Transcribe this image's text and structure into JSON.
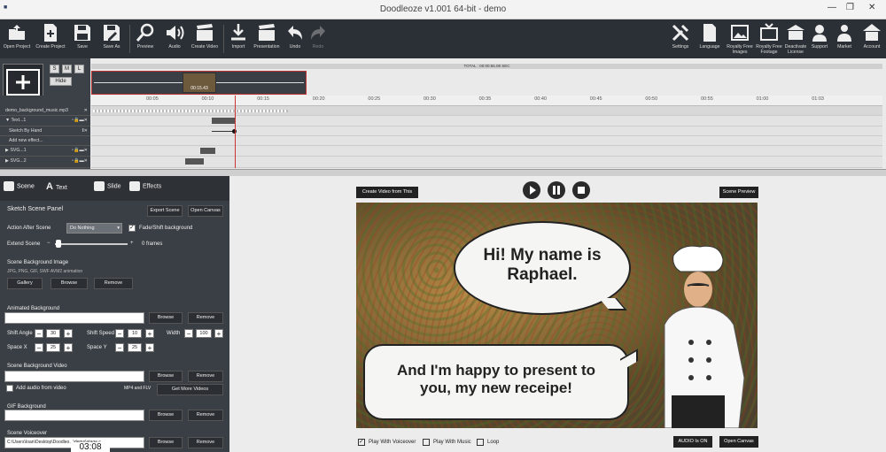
{
  "window": {
    "title": "Doodleoze v1.001 64-bit - demo"
  },
  "toolbar": {
    "left": [
      {
        "label": "Open Project",
        "icon": "folder-upload-icon"
      },
      {
        "label": "Create Project",
        "icon": "new-file-icon"
      },
      {
        "label": "Save",
        "icon": "save-icon"
      },
      {
        "label": "Save As",
        "icon": "save-as-icon"
      },
      {
        "label": "Preview",
        "icon": "magnifier-icon"
      },
      {
        "label": "Audio",
        "icon": "speaker-icon"
      },
      {
        "label": "Create Video",
        "icon": "clapperboard-icon"
      },
      {
        "label": "Import",
        "icon": "download-icon"
      },
      {
        "label": "Presentation",
        "icon": "clapperboard-icon"
      },
      {
        "label": "Undo",
        "icon": "undo-icon"
      },
      {
        "label": "Redo",
        "icon": "redo-icon"
      }
    ],
    "right": [
      {
        "label": "Settings",
        "icon": "tools-icon"
      },
      {
        "label": "Language",
        "icon": "document-icon"
      },
      {
        "label": "Royalty Free Images",
        "icon": "image-icon"
      },
      {
        "label": "Royalty Free Footage",
        "icon": "tv-icon"
      },
      {
        "label": "Deactivate License",
        "icon": "building-icon"
      },
      {
        "label": "Support",
        "icon": "support-agent-icon"
      },
      {
        "label": "Market",
        "icon": "market-person-icon"
      },
      {
        "label": "Account",
        "icon": "account-icon"
      }
    ]
  },
  "timeline": {
    "scene_size_buttons": [
      "S",
      "M",
      "L"
    ],
    "hide_label": "Hide",
    "total": "TOTAL :  00:00:55.08 SEC",
    "thumb_time": "00:15.43",
    "ticks": [
      "00:05",
      "00:10",
      "00:15",
      "00:20",
      "00:25",
      "00:30",
      "00:35",
      "00:40",
      "00:45",
      "00:50",
      "00:55",
      "01:00",
      "01:03"
    ],
    "audio_track": "demo_background_music.mp3",
    "tracks": [
      {
        "name": "Text...1"
      },
      {
        "name": "Sketch By Hand"
      },
      {
        "name": "Add new effect..."
      },
      {
        "name": "SVG...1"
      },
      {
        "name": "SVG...2"
      }
    ]
  },
  "left_panel": {
    "tabs": [
      "Scene",
      "Text",
      "Slide",
      "Effects"
    ],
    "heading": "Sketch Scene Panel",
    "export_scene": "Export Scene",
    "open_canvas": "Open Canvas",
    "action_after_scene_label": "Action After Scene",
    "action_after_scene_value": "Do Nothing",
    "fade_label": "Fade/Shift background",
    "extend_scene_label": "Extend Scene",
    "extend_minus": "−",
    "extend_plus": "+",
    "extend_value_label": "0 frames",
    "bg_image_label": "Scene Background Image",
    "bg_image_hint": "JPG, PNG, GIF, SWF AVM2 animation",
    "gallery": "Gallery",
    "browse": "Browse",
    "remove": "Remove",
    "animated_bg_label": "Animated Background",
    "shift_angle_label": "Shift Angle",
    "shift_angle_value": "30",
    "shift_speed_label": "Shift Speed",
    "shift_speed_value": "10",
    "width_label": "Width",
    "width_value": "100",
    "space_x_label": "Space X",
    "space_x_value": "25",
    "space_y_label": "Space Y",
    "space_y_value": "25",
    "bg_video_label": "Scene Background Video",
    "add_audio_label": "Add audio from video",
    "mp4_flv": "MP4 and FLV",
    "get_more_videos": "Get More Videos",
    "gif_bg_label": "GIF Background",
    "voiceover_label": "Scene Voiceover",
    "voiceover_path": "C:\\Users\\Ioan\\Desktop\\Doodleo...\\demo\\stage c"
  },
  "right_panel": {
    "create_video_scene": "Create Video from This Scene",
    "scene_preview": "Scene Preview",
    "bubble1": "Hi! My name is Raphael.",
    "bubble2": "And I'm happy to present to you, my new receipe!",
    "play_with_voiceover": "Play With Voiceover",
    "play_with_music": "Play With Music",
    "loop": "Loop",
    "audio_is_on": "AUDIO Is ON",
    "open_canvas": "Open Canvas"
  },
  "overlay": {
    "timer": "03:08"
  }
}
